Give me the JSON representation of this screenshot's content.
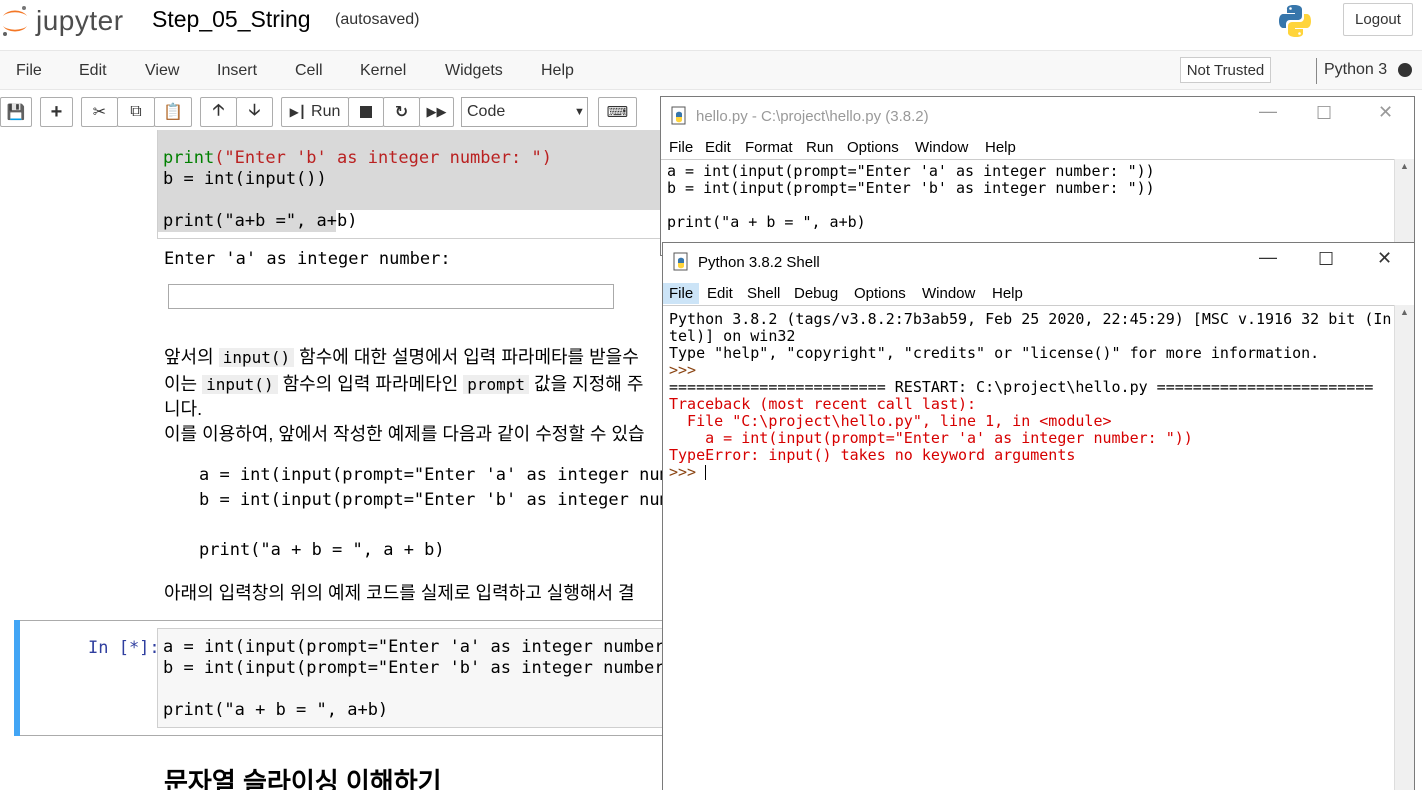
{
  "jupyter": {
    "logo_text": "jupyter",
    "notebook_title": "Step_05_String",
    "autosave": "(autosaved)",
    "logout_label": "Logout",
    "menu": [
      "File",
      "Edit",
      "View",
      "Insert",
      "Cell",
      "Kernel",
      "Widgets",
      "Help"
    ],
    "trust_label": "Not Trusted",
    "kernel_name": "Python 3",
    "toolbar": {
      "run_label": "Run",
      "cell_type": "Code"
    }
  },
  "notebook": {
    "cell1": {
      "line1_fn": "print",
      "line1_str": "(\"Enter 'b' as integer number: \")",
      "line2": "b = int(input())",
      "line3": "print(\"a+b =\", a+b)"
    },
    "input_prompt": "Enter 'a' as integer number:",
    "md": {
      "p1_a": "앞서의",
      "p1_code": "input()",
      "p1_b": "함수에 대한 설명에서 입력 파라메타를 받을수",
      "p2_a": "이는",
      "p2_code": "input()",
      "p2_b": "함수의 입력 파라메타인",
      "p2_code2": "prompt",
      "p2_c": "값을 지정해 주",
      "p3": "니다.",
      "p4": "이를 이용하여, 앞에서 작성한 예제를 다음과 같이 수정할 수 있습",
      "ex1": "a = int(input(prompt=\"Enter 'a' as integer number:",
      "ex2": "b = int(input(prompt=\"Enter 'b' as integer number:",
      "ex3": "print(\"a + b = \", a + b)",
      "p5": "아래의 입력창의 위의 예제 코드를 실제로 입력하고 실행해서 결"
    },
    "cell2": {
      "prompt": "In [*]:",
      "line1": "a = int(input(prompt=\"Enter 'a' as integer number: \"))",
      "line2": "b = int(input(prompt=\"Enter 'b' as integer number: \"))",
      "line3": "print(\"a + b = \", a+b)"
    },
    "heading": "문자열 슬라이싱 이해하기"
  },
  "editor": {
    "title": "hello.py - C:\\project\\hello.py (3.8.2)",
    "menu": [
      "File",
      "Edit",
      "Format",
      "Run",
      "Options",
      "Window",
      "Help"
    ],
    "lines": [
      "a = int(input(prompt=\"Enter 'a' as integer number: \"))",
      "b = int(input(prompt=\"Enter 'b' as integer number: \"))",
      "",
      "print(\"a + b = \", a+b)"
    ]
  },
  "shell": {
    "title": "Python 3.8.2 Shell",
    "menu": [
      "File",
      "Edit",
      "Shell",
      "Debug",
      "Options",
      "Window",
      "Help"
    ],
    "banner1": "Python 3.8.2 (tags/v3.8.2:7b3ab59, Feb 25 2020, 22:45:29) [MSC v.1916 32 bit (In",
    "banner2": "tel)] on win32",
    "banner3": "Type \"help\", \"copyright\", \"credits\" or \"license()\" for more information.",
    "prompt1": ">>> ",
    "restart": "======================== RESTART: C:\\project\\hello.py ========================",
    "tb1": "Traceback (most recent call last):",
    "tb2": "  File \"C:\\project\\hello.py\", line 1, in <module>",
    "tb3": "    a = int(input(prompt=\"Enter 'a' as integer number: \"))",
    "tb4": "TypeError: input() takes no keyword arguments",
    "prompt2": ">>> "
  }
}
